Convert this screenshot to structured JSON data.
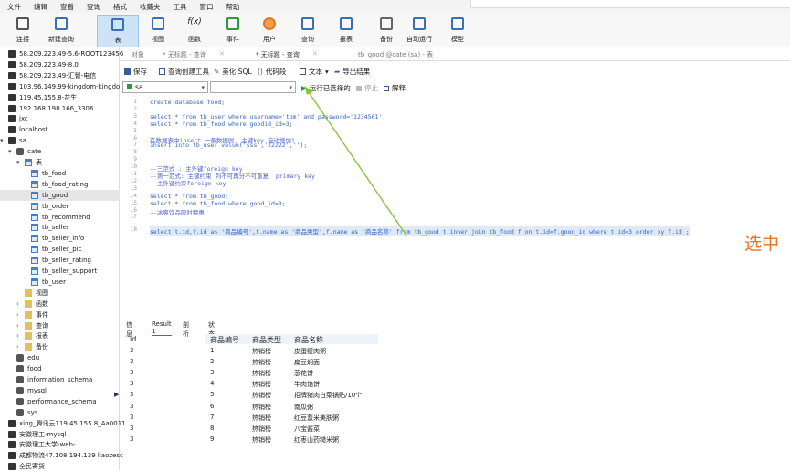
{
  "menubar": [
    "文件",
    "编辑",
    "查看",
    "查询",
    "格式",
    "收藏夹",
    "工具",
    "窗口",
    "帮助"
  ],
  "ribbon": [
    {
      "label": "连接",
      "icon": "connection-icon"
    },
    {
      "label": "新建查询",
      "icon": "new-query-icon"
    },
    {
      "label": "表",
      "icon": "table-icon"
    },
    {
      "label": "视图",
      "icon": "view-icon"
    },
    {
      "label": "函数",
      "icon": "function-icon"
    },
    {
      "label": "事件",
      "icon": "event-icon"
    },
    {
      "label": "用户",
      "icon": "user-icon"
    },
    {
      "label": "查询",
      "icon": "query-icon"
    },
    {
      "label": "报表",
      "icon": "report-icon"
    },
    {
      "label": "备份",
      "icon": "backup-icon"
    },
    {
      "label": "自动运行",
      "icon": "autorun-icon"
    },
    {
      "label": "模型",
      "icon": "model-icon"
    }
  ],
  "tabs": {
    "objects": "对象",
    "tab1": "* 无标题 - 查询",
    "tab2": "* 无标题 - 查询",
    "tab3": "tb_good @cate (sa) - 表"
  },
  "sidebar": {
    "connections_top": [
      "58.209.223.49-5.6-ROOT123456",
      "58.209.223.49-8.0",
      "58.209.223.49-汇智-电信",
      "103.96.149.99-kingdom-kingdo",
      "119.45.155.8-花生",
      "192.168.198.166_3306",
      "jxc",
      "localhost",
      "sa"
    ],
    "db_cate": "cate",
    "tables_folder": "表",
    "tables": [
      "tb_food",
      "tb_food_rating",
      "tb_good",
      "tb_order",
      "tb_recommend",
      "tb_seller",
      "tb_seller_info",
      "tb_seller_pic",
      "tb_seller_rating",
      "tb_seller_support",
      "tb_user"
    ],
    "folders": [
      "视图",
      "函数",
      "事件",
      "查询",
      "报表",
      "备份"
    ],
    "dbs": [
      "edu",
      "food",
      "information_schema",
      "mysql",
      "performance_schema",
      "sys"
    ],
    "connections_bottom": [
      "xing_腾讯云119.45.155.8_Aa0011",
      "安徽理工-mysql",
      "安徽理工大学-web-",
      "成都物流47.108.194.139 liaozesc",
      "全民寄货"
    ]
  },
  "toolbar": {
    "save": "保存",
    "query_builder": "查询创建工具",
    "beautify": "美化 SQL",
    "code_snippet": "代码段",
    "text": "文本",
    "export": "导出结果",
    "connection": "sa",
    "database": "",
    "run_selected": "运行已选择的",
    "stop": "停止",
    "explain": "解释"
  },
  "code_lines": [
    {
      "n": "1",
      "text": "create database food;"
    },
    {
      "n": "2",
      "text": ""
    },
    {
      "n": "3",
      "text": "select * from tb_user where username='tom' and password='1234561';"
    },
    {
      "n": "4",
      "text": "select * from tb_food where goodid_id=3;"
    },
    {
      "n": "5",
      "text": ""
    },
    {
      "n": "6",
      "text": "在数据表中insert 一条数据时, 主键key 自动增加1"
    },
    {
      "n": "7",
      "text": "insert into tb_user value('sss','22222','');"
    },
    {
      "n": "8",
      "text": ""
    },
    {
      "n": "9",
      "text": ""
    },
    {
      "n": "10",
      "text": "--三范式 : 主外键foreign key"
    },
    {
      "n": "11",
      "text": "--第一范式: 主键约束 列不可再分不可重复  primary key"
    },
    {
      "n": "12",
      "text": "--主外键约束foreign key"
    },
    {
      "n": "13",
      "text": ""
    },
    {
      "n": "14",
      "text": "select * from tb_good;"
    },
    {
      "n": "15",
      "text": "select * from tb_food where good_id=3;"
    },
    {
      "n": "16",
      "text": "--冰爽饮品限时特惠"
    },
    {
      "n": "17",
      "text": ""
    },
    {
      "n": "18",
      "text": "select t.id,f.id as '商品编号',t.name as '商品类型',f.name as '商品名称' from tb_good t inner join tb_food f on t.id=f.good_id where t.id=3 order by f.id ;"
    }
  ],
  "overlay_text": "选中",
  "results": {
    "tabs": [
      "信息",
      "Result 1",
      "剖析",
      "状态"
    ],
    "columns": [
      "id",
      "商品编号",
      "商品类型",
      "商品名称"
    ],
    "rows": [
      [
        "3",
        "1",
        "热销榜",
        "皮蛋瘦肉粥"
      ],
      [
        "3",
        "2",
        "热销榜",
        "扁豆焖面"
      ],
      [
        "3",
        "3",
        "热销榜",
        "葱花饼"
      ],
      [
        "3",
        "4",
        "热销榜",
        "牛肉馅饼"
      ],
      [
        "3",
        "5",
        "热销榜",
        "招牌猪肉白菜锅贴/10个"
      ],
      [
        "3",
        "6",
        "热销榜",
        "南瓜粥"
      ],
      [
        "3",
        "7",
        "热销榜",
        "红豆薏米美肤粥"
      ],
      [
        "3",
        "8",
        "热销榜",
        "八宝酱菜"
      ],
      [
        "3",
        "9",
        "热销榜",
        "红枣山药糙米粥"
      ]
    ]
  }
}
